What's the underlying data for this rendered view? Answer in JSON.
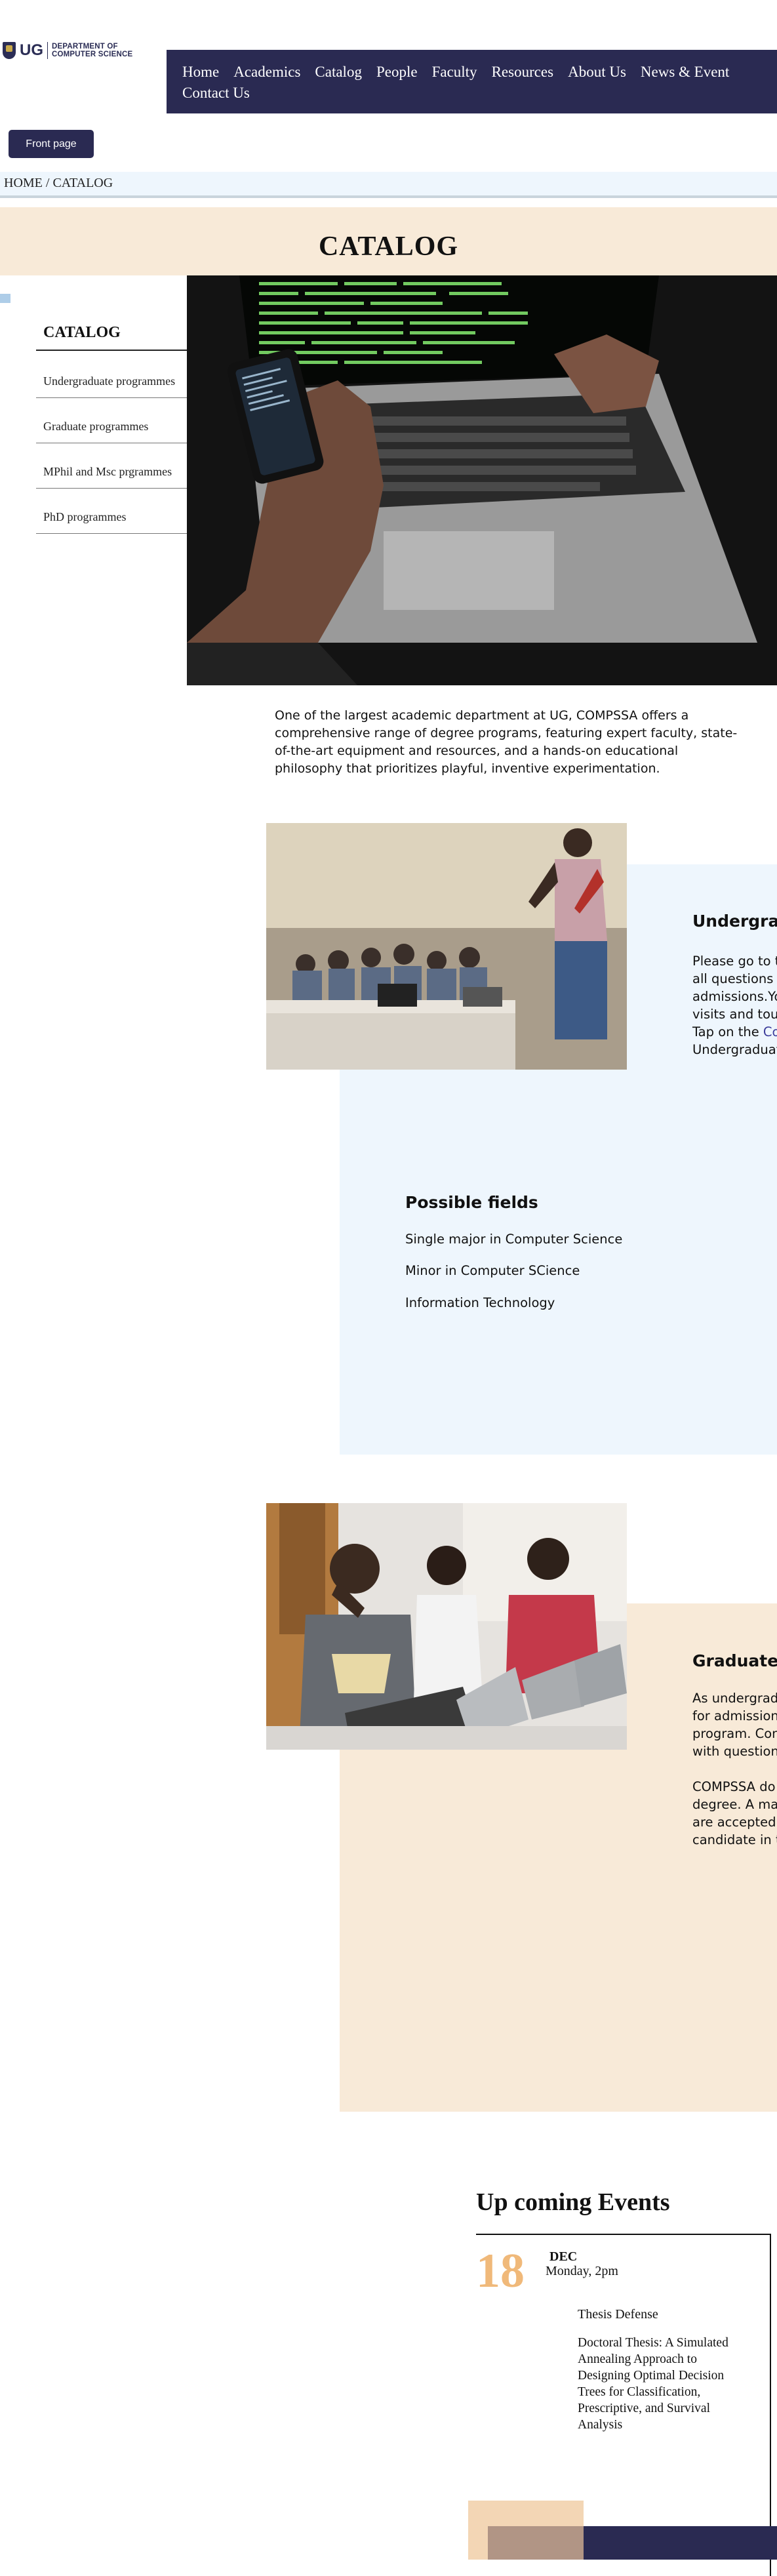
{
  "header": {
    "logo_text": "UG",
    "department_line1": "DEPARTMENT OF",
    "department_line2": "COMPUTER SCIENCE",
    "nav": [
      "Home",
      "Academics",
      "Catalog",
      "People",
      "Faculty",
      "Resources",
      "About Us",
      "News & Event",
      "Contact Us"
    ]
  },
  "front_page_button": "Front page",
  "breadcrumb": "HOME / CATALOG",
  "page_title": "CATALOG",
  "sidebar": {
    "heading": "CATALOG",
    "items": [
      "Undergraduate programmes",
      "Graduate programmes",
      "MPhil and Msc prgrammes",
      "PhD programmes"
    ]
  },
  "intro": "One of the largest academic department at UG, COMPSSA offers a comprehensive range of degree programs, featuring expert faculty, state-of-the-art equipment and resources, and a hands-on educational philosophy that prioritizes playful, inventive experimentation.",
  "undergraduate": {
    "title": "Undergrad",
    "lines": [
      "Please go to th",
      "all questions r",
      "admissions.Yo",
      "visits and tour"
    ],
    "tap_prefix": "Tap on the ",
    "tap_link": "Co",
    "last_line": "Undergraduate"
  },
  "possible_fields": {
    "title": "Possible fields",
    "items": [
      "Single major in Computer Science",
      "Minor in Computer SCience",
      "Information Technology"
    ]
  },
  "graduate": {
    "title": "Graduate",
    "lines": [
      "As undergradu",
      "for admission",
      "program. Con",
      "with question",
      "",
      "COMPSSA do",
      "degree. A mas",
      "are accepted a",
      "candidate in th"
    ]
  },
  "events": {
    "title": "Up coming Events",
    "day": "18",
    "month": "DEC",
    "time": "Monday, 2pm",
    "type": "Thesis Defense",
    "description": "Doctoral Thesis: A Simulated Annealing Approach to Designing Optimal Decision Trees for Classification, Prescriptive, and Survival Analysis"
  },
  "colors": {
    "navy": "#2a2a52",
    "peach": "#f8ead8",
    "light_blue": "#eef6fd",
    "accent_orange": "#f0b97a"
  }
}
